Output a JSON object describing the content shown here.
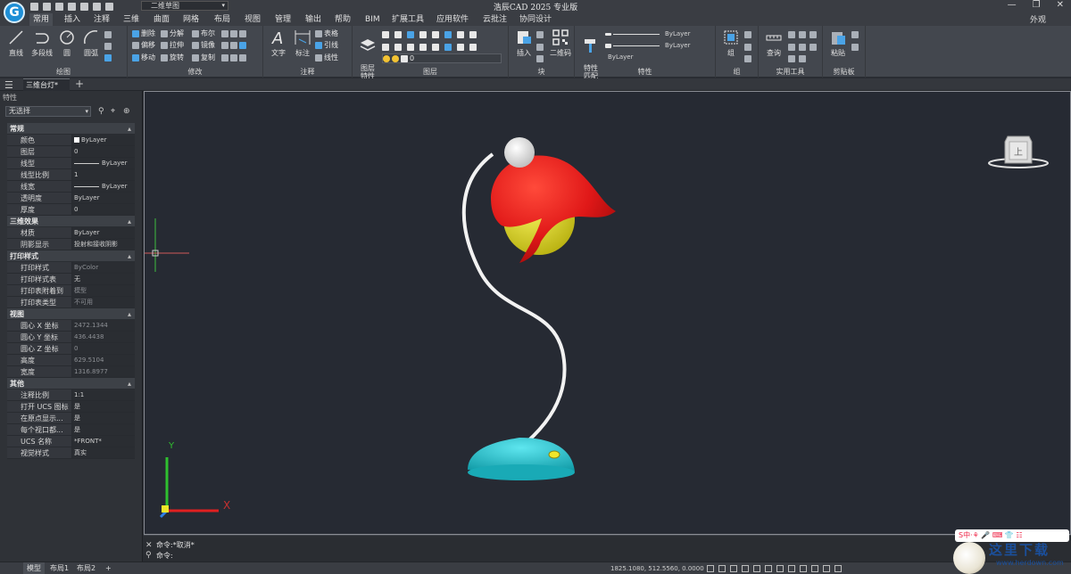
{
  "app": {
    "title": "浩辰CAD 2025 专业版",
    "workspace": "二维草图",
    "view_mode": "外观",
    "window_controls": [
      "—",
      "❐",
      "✕"
    ]
  },
  "menu": [
    "常用",
    "插入",
    "注释",
    "三维",
    "曲面",
    "网格",
    "布局",
    "视图",
    "管理",
    "输出",
    "帮助",
    "BIM",
    "扩展工具",
    "应用软件",
    "云批注",
    "协同设计"
  ],
  "ribbon": {
    "draw": {
      "label": "绘图",
      "line": "直线",
      "polyline": "多段线",
      "circle": "圆",
      "arc": "圆弧"
    },
    "modify": {
      "label": "修改",
      "items": [
        "删除",
        "分解",
        "布尔",
        "偏移",
        "拉伸",
        "镜像",
        "移动",
        "旋转",
        "复制"
      ]
    },
    "annotate": {
      "label": "注释",
      "text": "文字",
      "dim": "标注",
      "table": "表格",
      "leader": "引线",
      "linear": "线性"
    },
    "layer": {
      "label": "图层",
      "props": "图层\n特性",
      "current": "0"
    },
    "block": {
      "label": "块",
      "insert": "插入",
      "qrcode": "二维码"
    },
    "properties": {
      "label": "特性",
      "match": "特性\n匹配",
      "color": "ByLayer",
      "linetype": "ByLayer",
      "lineweight": "ByLayer"
    },
    "group": {
      "label": "组",
      "group": "组"
    },
    "utilities": {
      "label": "实用工具",
      "query": "查询"
    },
    "clipboard": {
      "label": "剪贴板",
      "paste": "粘贴"
    }
  },
  "document_tab": "三维台灯*",
  "panel": {
    "title": "特性",
    "selection": "无选择",
    "sections": [
      {
        "title": "常规",
        "rows": [
          {
            "k": "颜色",
            "v": "ByLayer"
          },
          {
            "k": "图层",
            "v": "0"
          },
          {
            "k": "线型",
            "v": "ByLayer"
          },
          {
            "k": "线型比例",
            "v": "1"
          },
          {
            "k": "线宽",
            "v": "ByLayer"
          },
          {
            "k": "透明度",
            "v": "ByLayer"
          },
          {
            "k": "厚度",
            "v": "0"
          }
        ]
      },
      {
        "title": "三维效果",
        "rows": [
          {
            "k": "材质",
            "v": "ByLayer"
          },
          {
            "k": "阴影显示",
            "v": "投射和接收阴影"
          }
        ]
      },
      {
        "title": "打印样式",
        "rows": [
          {
            "k": "打印样式",
            "v": "ByColor"
          },
          {
            "k": "打印样式表",
            "v": "无"
          },
          {
            "k": "打印表附着到",
            "v": "模型"
          },
          {
            "k": "打印表类型",
            "v": "不可用"
          }
        ]
      },
      {
        "title": "视图",
        "rows": [
          {
            "k": "圆心 X 坐标",
            "v": "2472.1344"
          },
          {
            "k": "圆心 Y 坐标",
            "v": "436.4438"
          },
          {
            "k": "圆心 Z 坐标",
            "v": "0"
          },
          {
            "k": "高度",
            "v": "629.5104"
          },
          {
            "k": "宽度",
            "v": "1316.8977"
          }
        ]
      },
      {
        "title": "其他",
        "rows": [
          {
            "k": "注释比例",
            "v": "1:1"
          },
          {
            "k": "打开 UCS 图标",
            "v": "是"
          },
          {
            "k": "在原点显示...",
            "v": "是"
          },
          {
            "k": "每个视口都...",
            "v": "是"
          },
          {
            "k": "UCS 名称",
            "v": "*FRONT*"
          },
          {
            "k": "视觉样式",
            "v": "真实"
          }
        ]
      }
    ]
  },
  "viewcube_label": "上",
  "ucs": {
    "x": "X",
    "y": "Y"
  },
  "command": {
    "line1": "命令:*取消*",
    "line2": "命令:"
  },
  "status": {
    "tabs": [
      "模型",
      "布局1",
      "布局2"
    ],
    "coords": "1825.1080, 512.5560, 0.0000"
  },
  "watermark": {
    "text": "这里下载",
    "url": "www.herdown.com",
    "bar": "S中·⚘ 🎤 ⌨ 👕 ☷"
  },
  "colors": {
    "viewport_bg": "#262a33",
    "lamp_shade": "#e01818",
    "lamp_inner": "#e6e020",
    "lamp_base": "#22c8d4",
    "lamp_arm": "#f2f2f2"
  }
}
